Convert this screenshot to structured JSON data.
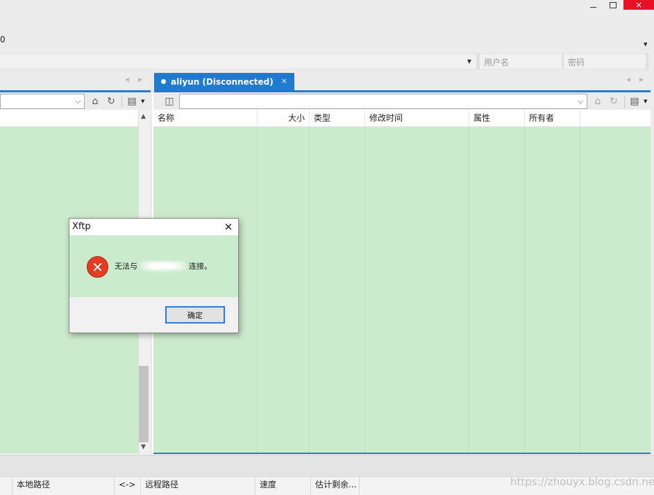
{
  "window": {
    "close_glyph": "×"
  },
  "menu": {
    "fragment": "0"
  },
  "connection": {
    "username_placeholder": "用户名",
    "password_placeholder": "密码"
  },
  "tabs": {
    "remote": {
      "label": "aliyun (Disconnected)",
      "close_glyph": "×"
    }
  },
  "remote_pane": {
    "columns": [
      "名称",
      "大小",
      "类型",
      "修改时间",
      "属性",
      "所有者"
    ]
  },
  "status_bar": {
    "columns": [
      "本地路径",
      "<->",
      "远程路径",
      "速度",
      "估计剩余..."
    ]
  },
  "watermark": "https://zhouyx.blog.csdn.net",
  "dialog": {
    "title": "Xftp",
    "message_prefix": "无法与",
    "message_suffix": "连接。",
    "ok_label": "确定",
    "close_glyph": "✕",
    "error_glyph": "✕"
  },
  "colors": {
    "accent": "#1f7bd2",
    "pane_bg": "#cbebcd",
    "error": "#e53c26"
  }
}
